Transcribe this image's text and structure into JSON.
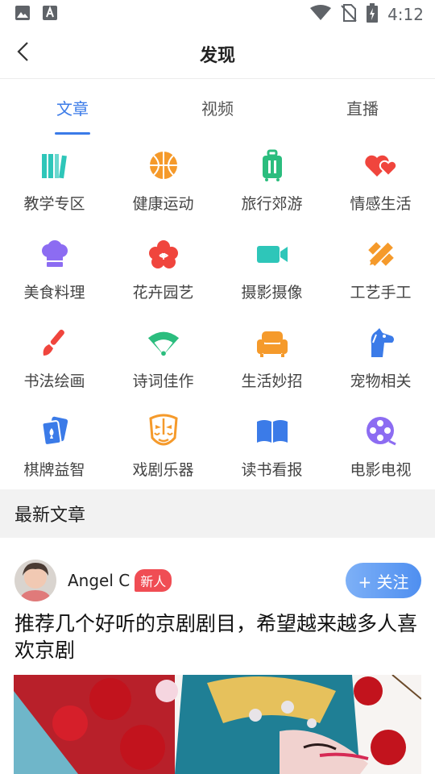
{
  "status_bar": {
    "time": "4:12",
    "icons": [
      "image-icon",
      "a-font-icon",
      "wifi-icon",
      "no-sim-icon",
      "battery-charging-icon"
    ]
  },
  "header": {
    "title": "发现",
    "back_icon": "chevron-left-icon"
  },
  "tabs": [
    {
      "label": "文章",
      "active": true
    },
    {
      "label": "视频",
      "active": false
    },
    {
      "label": "直播",
      "active": false
    }
  ],
  "categories": [
    {
      "label": "教学专区",
      "icon": "books-icon",
      "color": "#2ec6b9"
    },
    {
      "label": "健康运动",
      "icon": "basketball-icon",
      "color": "#f59a2b"
    },
    {
      "label": "旅行郊游",
      "icon": "suitcase-icon",
      "color": "#2bbd7e"
    },
    {
      "label": "情感生活",
      "icon": "hearts-icon",
      "color": "#f0453d"
    },
    {
      "label": "美食料理",
      "icon": "chef-hat-icon",
      "color": "#8c6cf2"
    },
    {
      "label": "花卉园艺",
      "icon": "flower-icon",
      "color": "#f0453d"
    },
    {
      "label": "摄影摄像",
      "icon": "video-camera-icon",
      "color": "#2ec6b9"
    },
    {
      "label": "工艺手工",
      "icon": "pencil-ruler-icon",
      "color": "#f59a2b"
    },
    {
      "label": "书法绘画",
      "icon": "paintbrush-icon",
      "color": "#f0453d"
    },
    {
      "label": "诗词佳作",
      "icon": "fan-icon",
      "color": "#2bbd7e"
    },
    {
      "label": "生活妙招",
      "icon": "sofa-icon",
      "color": "#f59a2b"
    },
    {
      "label": "宠物相关",
      "icon": "dog-icon",
      "color": "#3b7be8"
    },
    {
      "label": "棋牌益智",
      "icon": "cards-icon",
      "color": "#3b7be8"
    },
    {
      "label": "戏剧乐器",
      "icon": "opera-mask-icon",
      "color": "#f59a2b"
    },
    {
      "label": "读书看报",
      "icon": "open-book-icon",
      "color": "#3b7be8"
    },
    {
      "label": "电影电视",
      "icon": "film-reel-icon",
      "color": "#8c6cf2"
    }
  ],
  "section": {
    "title": "最新文章"
  },
  "article": {
    "author": "Angel C",
    "badge": "新人",
    "follow_label": "+ 关注",
    "title": "推荐几个好听的京剧剧目，希望越来越多人喜欢京剧"
  },
  "colors": {
    "accent": "#3b7be8",
    "badge": "#f04d54",
    "section_bg": "#f2f2f2"
  }
}
